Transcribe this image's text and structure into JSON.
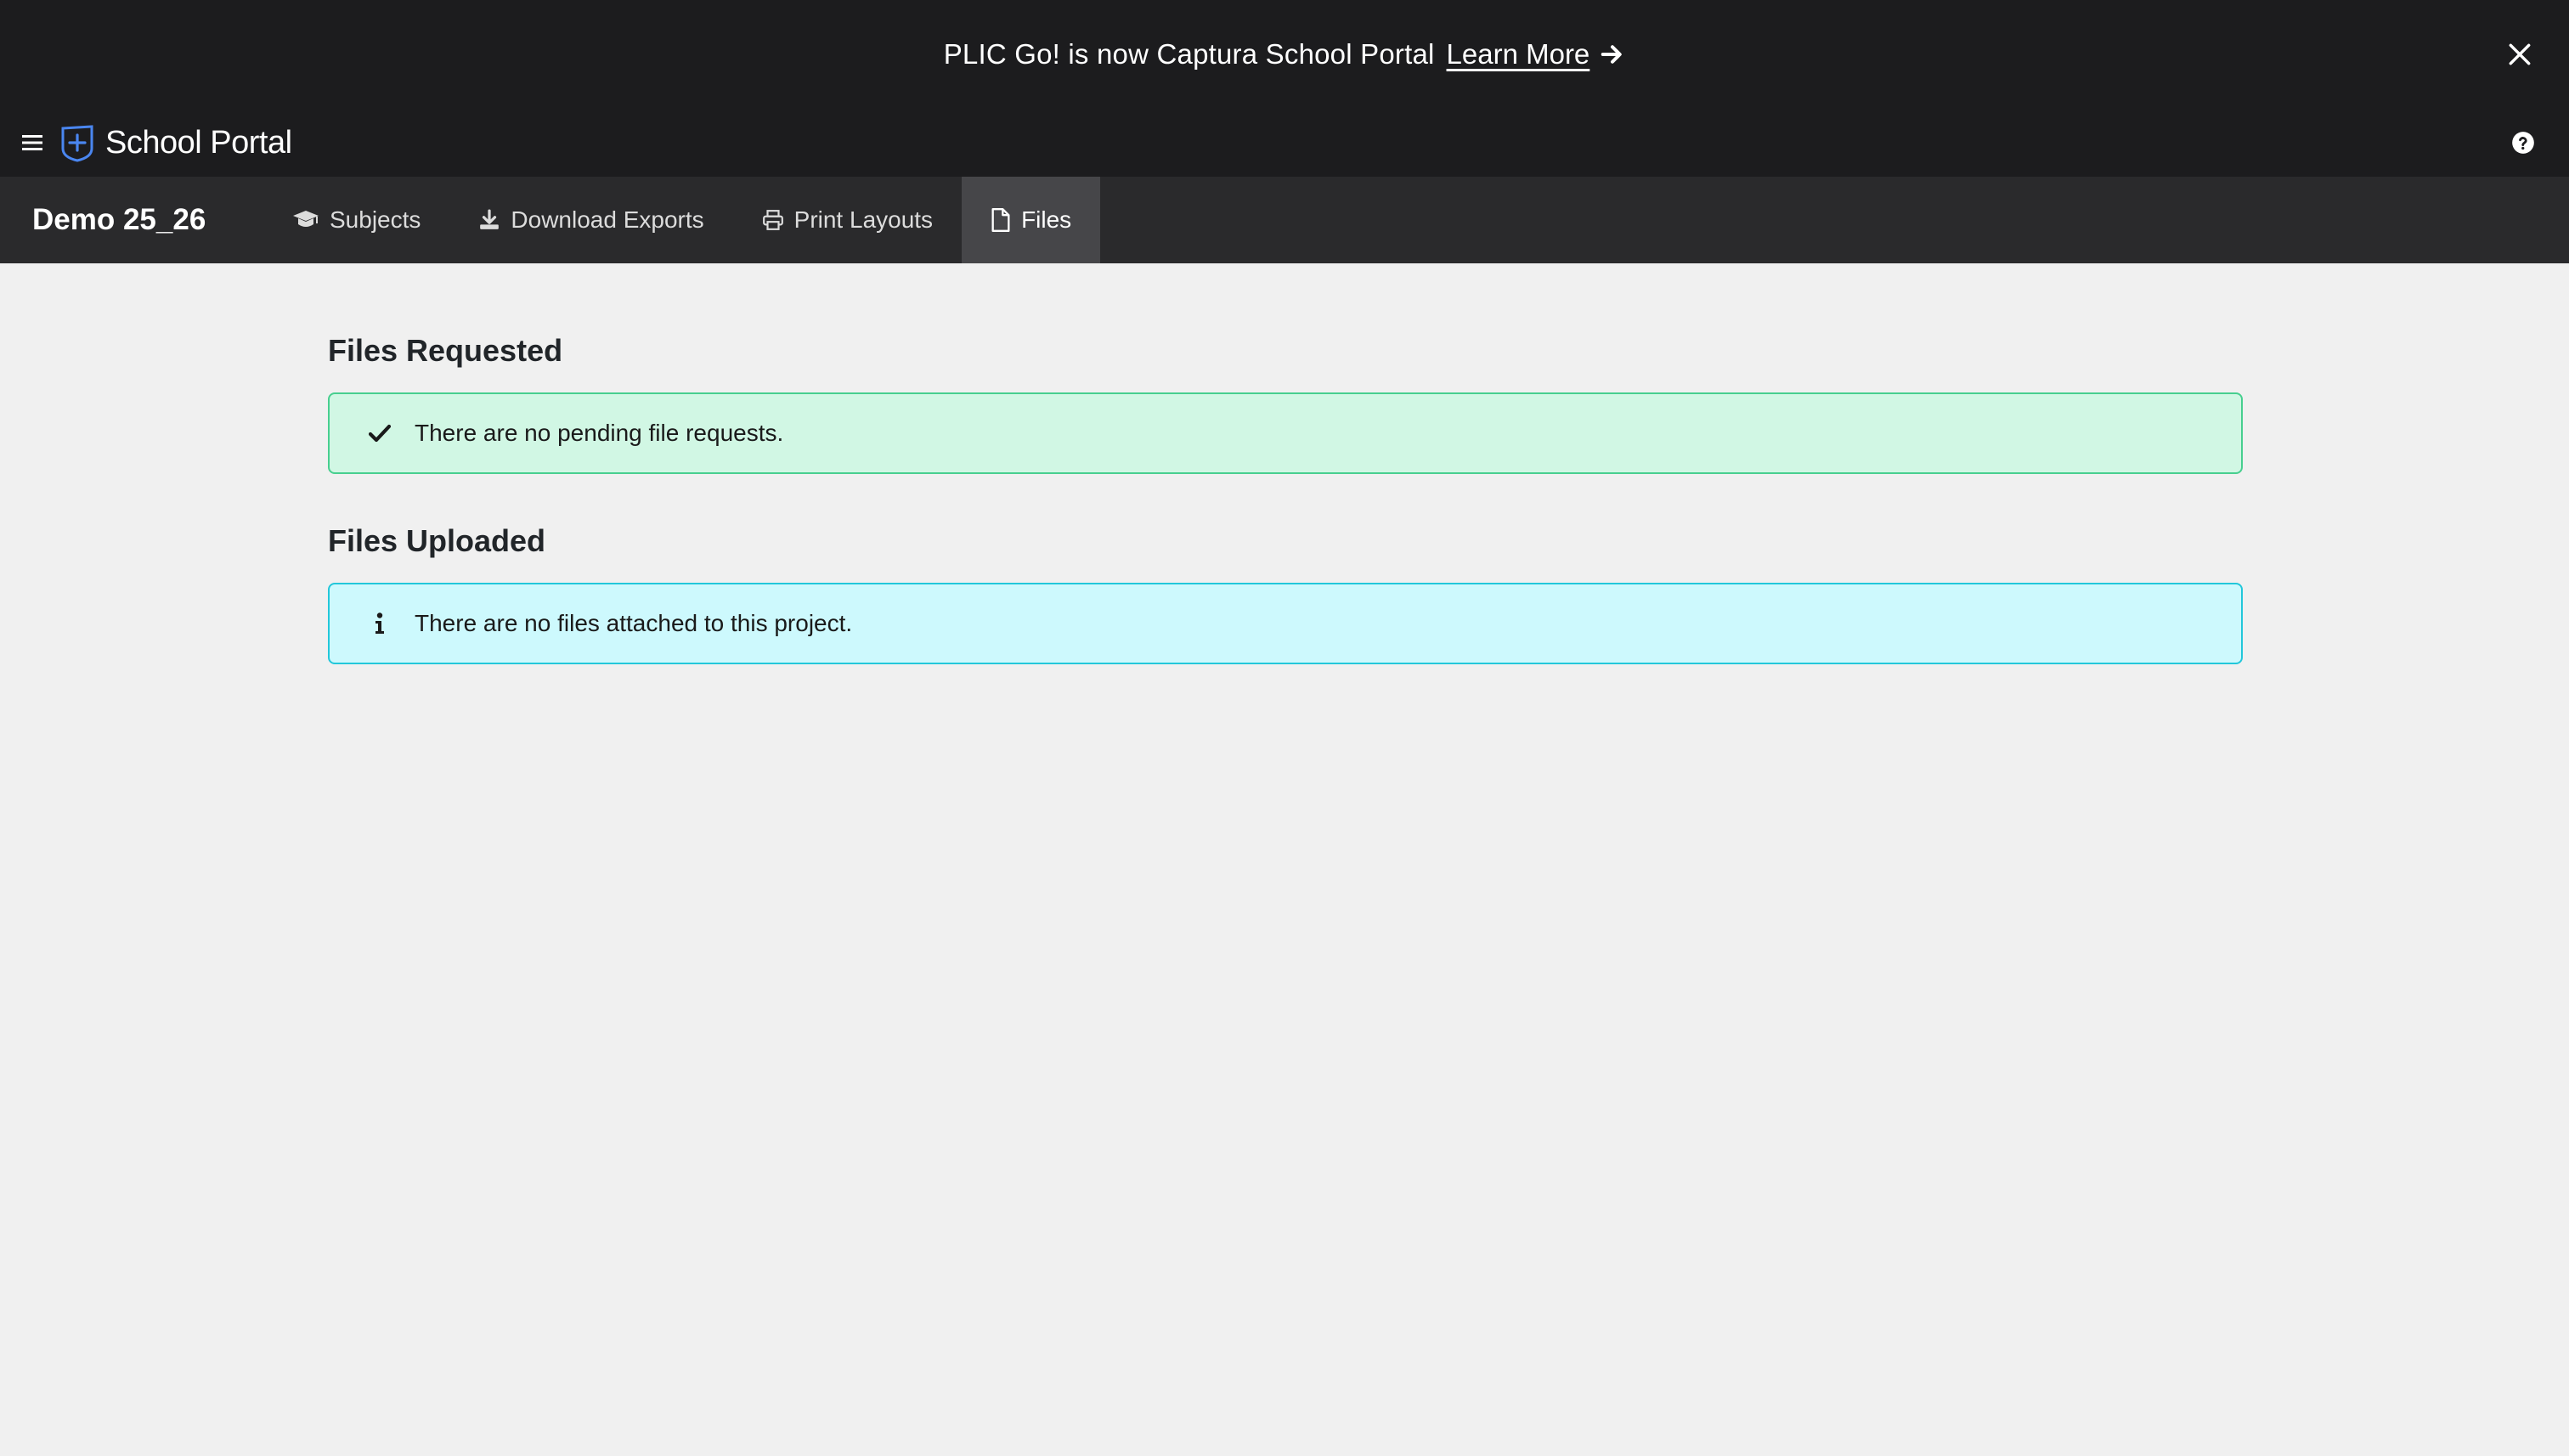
{
  "banner": {
    "text": "PLIC Go! is now Captura School Portal",
    "link_label": "Learn More"
  },
  "app": {
    "name": "School Portal",
    "accent": "#4a86f0"
  },
  "project": {
    "title": "Demo 25_26"
  },
  "nav": {
    "tabs": [
      {
        "label": "Subjects",
        "icon": "graduation-cap-icon"
      },
      {
        "label": "Download Exports",
        "icon": "download-icon"
      },
      {
        "label": "Print Layouts",
        "icon": "printer-icon"
      },
      {
        "label": "Files",
        "icon": "file-icon",
        "active": true
      }
    ]
  },
  "main": {
    "requested": {
      "title": "Files Requested",
      "message": "There are no pending file requests.",
      "icon": "check-icon",
      "color": "#47cf8f"
    },
    "uploaded": {
      "title": "Files Uploaded",
      "message": "There are no files attached to this project.",
      "icon": "info-icon",
      "color": "#22c7da"
    }
  }
}
